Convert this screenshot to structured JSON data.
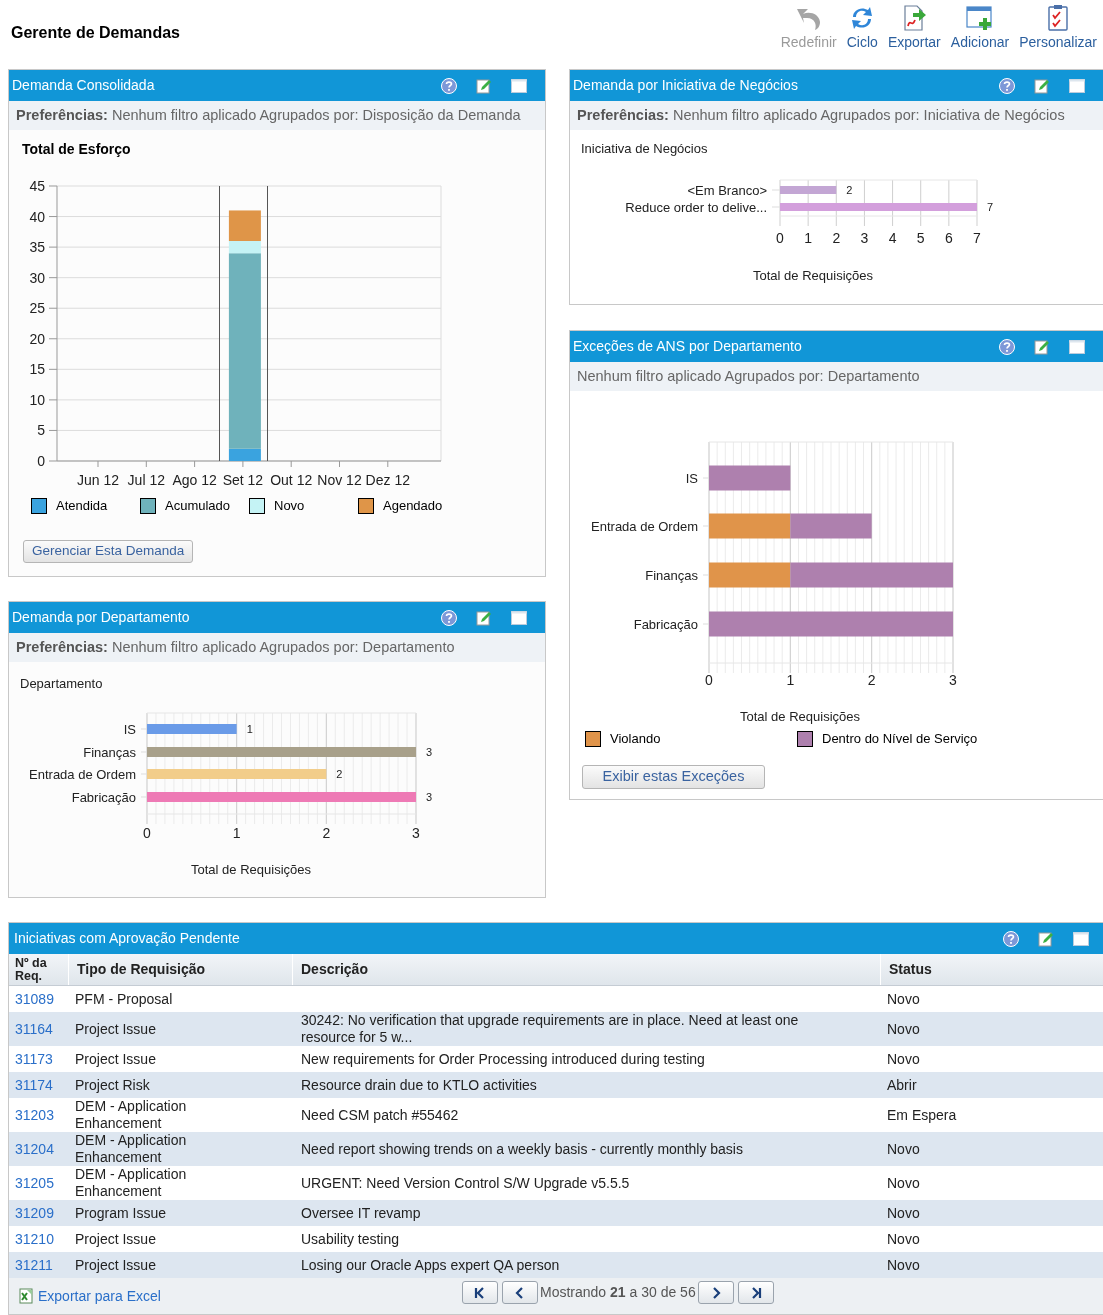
{
  "page_title": "Gerente de Demandas",
  "toolbar": [
    {
      "label": "Redefinir",
      "kind": "undo",
      "disabled": true
    },
    {
      "label": "Ciclo",
      "kind": "refresh",
      "disabled": false
    },
    {
      "label": "Exportar",
      "kind": "export",
      "disabled": false
    },
    {
      "label": "Adicionar",
      "kind": "add",
      "disabled": false
    },
    {
      "label": "Personalizar",
      "kind": "customize",
      "disabled": false
    }
  ],
  "left_column": [
    {
      "title": "Demanda Consolidada",
      "preferences": "**Preferências:** Nenhum filtro aplicado Agrupados por: Disposição da Demanda",
      "chart_data": {
        "type": "bar",
        "orientation": "vertical",
        "stacked": true,
        "title": "Total de Esforço",
        "categories": [
          "Jun 12",
          "Jul 12",
          "Ago 12",
          "Set  12",
          "Out 12",
          "Nov 12",
          "Dez 12"
        ],
        "series": [
          {
            "name": "Atendida",
            "color": "#3aa3df",
            "values": [
              0,
              0,
              0,
              2,
              0,
              0,
              0
            ]
          },
          {
            "name": "Acumulado",
            "color": "#6fb2bb",
            "values": [
              0,
              0,
              0,
              32,
              0,
              0,
              0
            ]
          },
          {
            "name": "Novo",
            "color": "#c5f3f5",
            "values": [
              0,
              0,
              0,
              2,
              0,
              0,
              0
            ]
          },
          {
            "name": "Agendado",
            "color": "#df9548",
            "values": [
              0,
              0,
              0,
              5,
              0,
              0,
              0
            ]
          }
        ],
        "grid": true,
        "legend": "bottom",
        "ylim": [
          0,
          45
        ],
        "yticks": [
          0,
          5,
          10,
          15,
          20,
          25,
          30,
          35,
          40,
          45
        ]
      },
      "button": "Gerenciar Esta Demanda"
    },
    {
      "title": "Demanda por Departamento",
      "preferences": "**Preferências:** Nenhum filtro aplicado Agrupados por: Departamento",
      "chart_data": {
        "type": "bar",
        "orientation": "horizontal",
        "ylabel": "Departamento",
        "xlabel": "Total de Requisições",
        "categories": [
          "IS",
          "Finanças",
          "Entrada de Ordem",
          "Fabricação"
        ],
        "series": [
          {
            "colors": [
              "#6a9be8",
              "#a8a08a",
              "#f2cd8a",
              "#ee7ab5"
            ],
            "values": [
              1,
              3,
              2,
              3
            ]
          }
        ],
        "grid": true,
        "xlim": [
          0,
          3
        ],
        "xticks": [
          0,
          1,
          2,
          3
        ],
        "data_labels": true
      }
    }
  ],
  "right_column": [
    {
      "title": "Demanda por Iniciativa de Negócios",
      "preferences": "**Preferências:** Nenhum filtro aplicado Agrupados por: Iniciativa de Negócios",
      "chart_data": {
        "type": "bar",
        "orientation": "horizontal",
        "ylabel": "Iniciativa de Negócios",
        "xlabel": "Total de Requisições",
        "categories": [
          "<Em Branco>",
          "Reduce order to delive..."
        ],
        "series": [
          {
            "colors": [
              "#c3a6d4",
              "#d39fdc"
            ],
            "values": [
              2,
              7
            ]
          }
        ],
        "grid": true,
        "xlim": [
          0,
          7
        ],
        "xticks": [
          0,
          1,
          2,
          3,
          4,
          5,
          6,
          7
        ],
        "data_labels": true
      }
    },
    {
      "title": "Exceções de ANS por Departamento",
      "preferences": "Nenhum filtro aplicado Agrupados por: Departamento",
      "chart_data": {
        "type": "bar",
        "orientation": "horizontal",
        "stacked": true,
        "xlabel": "Total de Requisições",
        "categories": [
          "IS",
          "Entrada de Ordem",
          "Finanças",
          "Fabricação"
        ],
        "series": [
          {
            "name": "Violando",
            "color": "#e0944a",
            "values": [
              0,
              1,
              1,
              0
            ]
          },
          {
            "name": "Dentro do Nível de Serviço",
            "color": "#ae80ae",
            "values": [
              1,
              1,
              2,
              3
            ]
          }
        ],
        "grid": true,
        "legend": "bottom",
        "xlim": [
          0,
          3
        ],
        "xticks": [
          0,
          1,
          2,
          3
        ]
      },
      "button": "Exibir estas Exceções"
    }
  ],
  "table": {
    "title": "Iniciativas com Aprovação Pendente",
    "columns": [
      "Nº da Req.",
      "Tipo de Requisição",
      "Descrição",
      "Status"
    ],
    "rows": [
      {
        "id": "31089",
        "type": "PFM - Proposal",
        "status": "Novo"
      },
      {
        "id": "31164",
        "type": "Project Issue",
        "description": "30242: No verification that upgrade requirements are in place. Need at least one resource for 5 w...",
        "status": "Novo"
      },
      {
        "id": "31173",
        "type": "Project Issue",
        "description": "New requirements for Order Processing introduced during testing",
        "status": "Novo"
      },
      {
        "id": "31174",
        "type": "Project Risk",
        "description": "Resource drain due to KTLO activities",
        "status": "Abrir"
      },
      {
        "id": "31203",
        "type": "DEM - Application Enhancement",
        "description": "Need CSM patch #55462",
        "status": "Em Espera"
      },
      {
        "id": "31204",
        "type": "DEM - Application Enhancement",
        "description": "Need report showing trends on a weekly basis - currently monthly basis",
        "status": "Novo"
      },
      {
        "id": "31205",
        "type": "DEM - Application Enhancement",
        "description": "URGENT: Need Version Control S/W Upgrade v5.5.5",
        "status": "Novo"
      },
      {
        "id": "31209",
        "type": "Program Issue",
        "description": "Oversee IT revamp",
        "status": "Novo"
      },
      {
        "id": "31210",
        "type": "Project Issue",
        "description": "Usability testing",
        "status": "Novo"
      },
      {
        "id": "31211",
        "type": "Project Issue",
        "description": "Losing our Oracle Apps expert QA person",
        "status": "Novo"
      }
    ],
    "export_link": "Exportar para Excel",
    "paging": "Mostrando **21** a 30 de 56"
  }
}
